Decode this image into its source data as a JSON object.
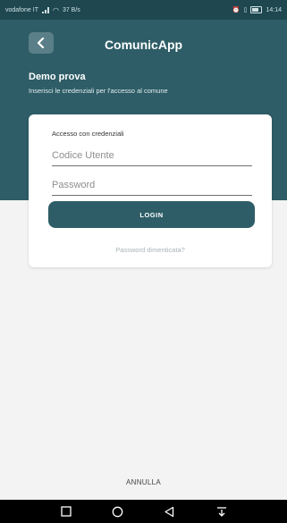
{
  "status_bar": {
    "carrier": "vodafone IT",
    "network_speed": "37 B/s",
    "time": "14:14"
  },
  "header": {
    "title": "ComunicApp"
  },
  "intro": {
    "title": "Demo prova",
    "subtitle": "Inserisci le credenziali per l'accesso al comune"
  },
  "login_card": {
    "label": "Accesso con credenziali",
    "username_placeholder": "Codice Utente",
    "password_placeholder": "Password",
    "login_label": "LOGIN",
    "forgot_label": "Password dimenticata?"
  },
  "footer": {
    "cancel_label": "ANNULLA"
  },
  "colors": {
    "primary": "#2e5d67",
    "background": "#f3f3f3"
  }
}
